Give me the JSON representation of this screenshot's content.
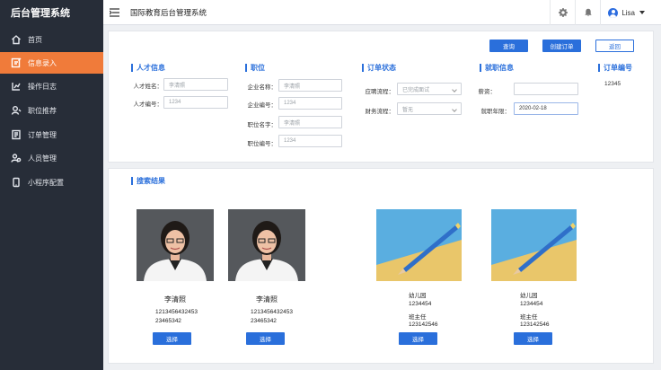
{
  "sidebar": {
    "brand": "后台管理系统",
    "items": [
      {
        "label": "首页",
        "icon": "home-icon"
      },
      {
        "label": "信息录入",
        "icon": "edit-icon",
        "active": true
      },
      {
        "label": "操作日志",
        "icon": "log-icon"
      },
      {
        "label": "职位推荐",
        "icon": "user-search-icon"
      },
      {
        "label": "订单管理",
        "icon": "order-icon"
      },
      {
        "label": "人员管理",
        "icon": "people-icon"
      },
      {
        "label": "小程序配置",
        "icon": "mini-program-icon"
      }
    ]
  },
  "header": {
    "title": "国际教育后台管理系统",
    "user": "Lisa"
  },
  "toolbar": {
    "query": "查询",
    "create_order": "创建订单",
    "back": "返回"
  },
  "form": {
    "talent": {
      "title": "人才信息",
      "name_label": "人才姓名：",
      "name_value": "李清照",
      "id_label": "人才编号：",
      "id_value": "1234"
    },
    "position": {
      "title": "职位",
      "company_label": "企业名称：",
      "company_value": "李清照",
      "company_id_label": "企业编号：",
      "company_id_value": "1234",
      "job_label": "职位名字：",
      "job_value": "李清照",
      "job_id_label": "职位编号：",
      "job_id_value": "1234"
    },
    "order_status": {
      "title": "订单状态",
      "apply_label": "应聘流程：",
      "apply_value": "已完成面试",
      "finance_label": "财务流程：",
      "finance_value": "暂无"
    },
    "employment": {
      "title": "就职信息",
      "salary_label": "薪资：",
      "salary_value": "",
      "date_label": "就职年限：",
      "date_value": "2020-02-18"
    },
    "order_no": {
      "title": "订单编号",
      "value": "12345"
    }
  },
  "results": {
    "title": "搜索结果",
    "select_label": "选择",
    "people": [
      {
        "name": "李清照",
        "line1": "1213456432453",
        "line2": "23465342"
      },
      {
        "name": "李清照",
        "line1": "1213456432453",
        "line2": "23465342"
      }
    ],
    "schools": [
      {
        "line1": "幼儿园",
        "line2": "1234454",
        "line3": "班主任",
        "line4": "123142546"
      },
      {
        "line1": "幼儿园",
        "line2": "1234454",
        "line3": "班主任",
        "line4": "123142546"
      }
    ]
  },
  "colors": {
    "sidebar_bg": "#272d38",
    "active_item": "#f07b3a",
    "primary": "#2a6fdb"
  }
}
